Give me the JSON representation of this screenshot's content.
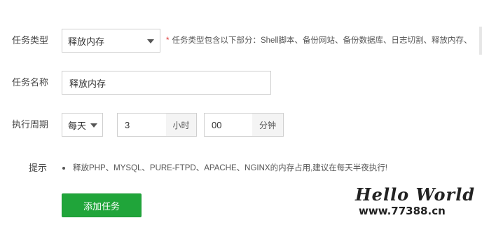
{
  "form": {
    "task_type": {
      "label": "任务类型",
      "selected": "释放内存",
      "hint_star": "*",
      "hint": "任务类型包含以下部分：Shell脚本、备份网站、备份数据库、日志切割、释放内存、"
    },
    "task_name": {
      "label": "任务名称",
      "value": "释放内存"
    },
    "period": {
      "label": "执行周期",
      "frequency": "每天",
      "hour_value": "3",
      "hour_unit": "小时",
      "minute_value": "00",
      "minute_unit": "分钟"
    },
    "tip": {
      "label": "提示",
      "text": "释放PHP、MYSQL、PURE-FTPD、APACHE、NGINX的内存占用,建议在每天半夜执行!"
    },
    "submit_label": "添加任务"
  },
  "watermark": {
    "title": "Hello World",
    "url": "www.77388.cn"
  },
  "colors": {
    "accent": "#20a53a",
    "required": "#e04040"
  }
}
